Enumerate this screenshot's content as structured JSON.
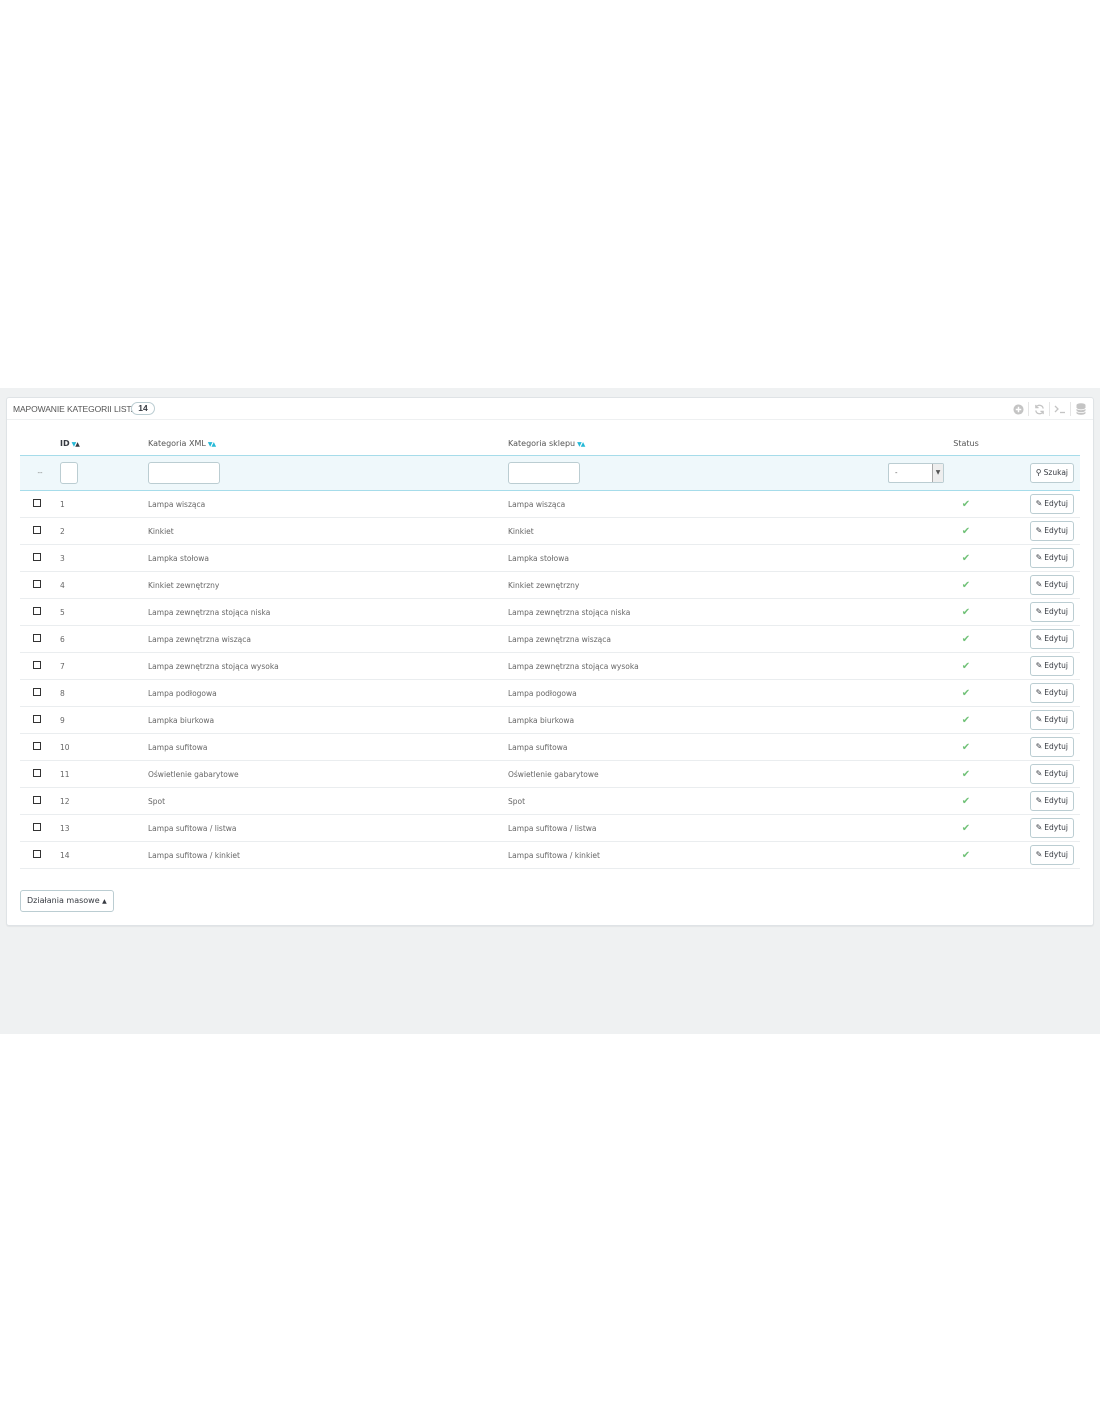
{
  "panel": {
    "title": "MAPOWANIE KATEGORII LISTA",
    "count": "14",
    "toolbar": [
      "add-icon",
      "refresh-icon",
      "terminal-icon",
      "database-icon"
    ]
  },
  "columns": {
    "id": "ID",
    "xml": "Kategoria XML",
    "shop": "Kategoria sklepu",
    "status": "Status"
  },
  "filter": {
    "dash": "--",
    "status_value": "-",
    "search_label": "Szukaj"
  },
  "rows": [
    {
      "id": "1",
      "xml": "Lampa wisząca",
      "shop": "Lampa wisząca",
      "edit": "Edytuj"
    },
    {
      "id": "2",
      "xml": "Kinkiet",
      "shop": "Kinkiet",
      "edit": "Edytuj"
    },
    {
      "id": "3",
      "xml": "Lampka stołowa",
      "shop": "Lampka stołowa",
      "edit": "Edytuj"
    },
    {
      "id": "4",
      "xml": "Kinkiet zewnętrzny",
      "shop": "Kinkiet zewnętrzny",
      "edit": "Edytuj"
    },
    {
      "id": "5",
      "xml": "Lampa zewnętrzna stojąca niska",
      "shop": "Lampa zewnętrzna stojąca niska",
      "edit": "Edytuj"
    },
    {
      "id": "6",
      "xml": "Lampa zewnętrzna wisząca",
      "shop": "Lampa zewnętrzna wisząca",
      "edit": "Edytuj"
    },
    {
      "id": "7",
      "xml": "Lampa zewnętrzna stojąca wysoka",
      "shop": "Lampa zewnętrzna stojąca wysoka",
      "edit": "Edytuj"
    },
    {
      "id": "8",
      "xml": "Lampa podłogowa",
      "shop": "Lampa podłogowa",
      "edit": "Edytuj"
    },
    {
      "id": "9",
      "xml": "Lampka biurkowa",
      "shop": "Lampka biurkowa",
      "edit": "Edytuj"
    },
    {
      "id": "10",
      "xml": "Lampa sufitowa",
      "shop": "Lampa sufitowa",
      "edit": "Edytuj"
    },
    {
      "id": "11",
      "xml": "Oświetlenie gabarytowe",
      "shop": "Oświetlenie gabarytowe",
      "edit": "Edytuj"
    },
    {
      "id": "12",
      "xml": "Spot",
      "shop": "Spot",
      "edit": "Edytuj"
    },
    {
      "id": "13",
      "xml": "Lampa sufitowa / listwa",
      "shop": "Lampa sufitowa / listwa",
      "edit": "Edytuj"
    },
    {
      "id": "14",
      "xml": "Lampa sufitowa / kinkiet",
      "shop": "Lampa sufitowa / kinkiet",
      "edit": "Edytuj"
    }
  ],
  "bulk_actions": "Działania masowe",
  "colors": {
    "accent": "#25b9d7",
    "status_ok": "#72c279",
    "background": "#eff1f2"
  }
}
